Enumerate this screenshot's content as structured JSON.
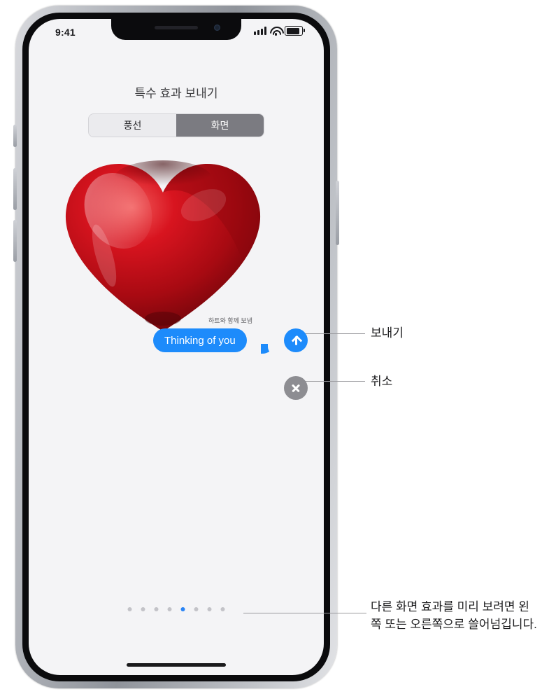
{
  "device": {
    "status_bar": {
      "time": "9:41",
      "signal_icon": "cellular-signal-icon",
      "wifi_icon": "wifi-icon",
      "battery_icon": "battery-full-icon"
    }
  },
  "screen": {
    "title": "특수 효과 보내기",
    "segmented_control": {
      "options": [
        {
          "label": "풍선",
          "selected": false
        },
        {
          "label": "화면",
          "selected": true
        }
      ]
    },
    "effect_preview": {
      "name": "heart-balloon-effect",
      "caption": "하트와 함께 보냄",
      "accent_color": "#c8101a"
    },
    "message_bubble": {
      "text": "Thinking of you",
      "color": "#1d8bfb"
    },
    "controls": {
      "send": {
        "label": "send-button",
        "icon": "arrow-up-icon",
        "color": "#1d8bfb"
      },
      "cancel": {
        "label": "cancel-button",
        "icon": "close-x-icon",
        "color": "#8d8d92"
      }
    },
    "page_dots": {
      "total": 8,
      "active_index": 4
    }
  },
  "callouts": [
    {
      "name": "send",
      "text": "보내기"
    },
    {
      "name": "cancel",
      "text": "취소"
    },
    {
      "name": "swipe",
      "text": "다른 화면 효과를 미리 보려면 왼쪽 또는 오른쪽으로 쓸어넘깁니다."
    }
  ]
}
